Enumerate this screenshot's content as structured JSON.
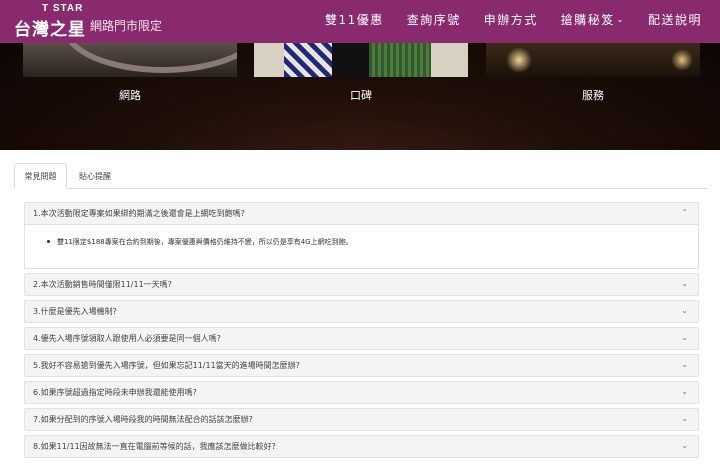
{
  "header": {
    "logo_top": "T STAR",
    "logo_main": "台灣之星",
    "tagline": "網路門市限定",
    "nav": [
      {
        "label": "雙11優惠",
        "dropdown": false
      },
      {
        "label": "查詢序號",
        "dropdown": false
      },
      {
        "label": "申辦方式",
        "dropdown": false
      },
      {
        "label": "搶購秘笈",
        "dropdown": true
      },
      {
        "label": "配送說明",
        "dropdown": false
      }
    ],
    "color": "#8a2a6e"
  },
  "hero": {
    "tiles": [
      {
        "label": "網路"
      },
      {
        "label": "口碑"
      },
      {
        "label": "服務"
      }
    ]
  },
  "tabs": [
    {
      "label": "常見問題",
      "active": true
    },
    {
      "label": "貼心提醒",
      "active": false
    }
  ],
  "faq": {
    "open": {
      "question": "1.本次活動限定專案如果綁約期滿之後還會是上網吃到飽嗎?",
      "answer": "雙11限定$188專案在合約到期後，專案優惠與價格仍維持不變，所以仍是享有4G上網吃到飽。"
    },
    "items": [
      "2.本次活動銷售時間僅限11/11一天嗎?",
      "3.什麼是優先入場機制?",
      "4.優先入場序號領取人跟使用人必須要是同一個人嗎?",
      "5.我好不容易搶到優先入場序號，但如果忘記11/11當天的進場時間怎麼辦?",
      "6.如果序號超過指定時段未申辦我還能使用嗎?",
      "7.如果分配到的序號入場時段我的時間無法配合的話該怎麼辦?",
      "8.如果11/11因故無法一直在電腦前等候的話，我應該怎麼做比較好?"
    ]
  },
  "icons": {
    "expanded": "chevron-up-icon",
    "collapsed": "chevron-down-icon"
  }
}
